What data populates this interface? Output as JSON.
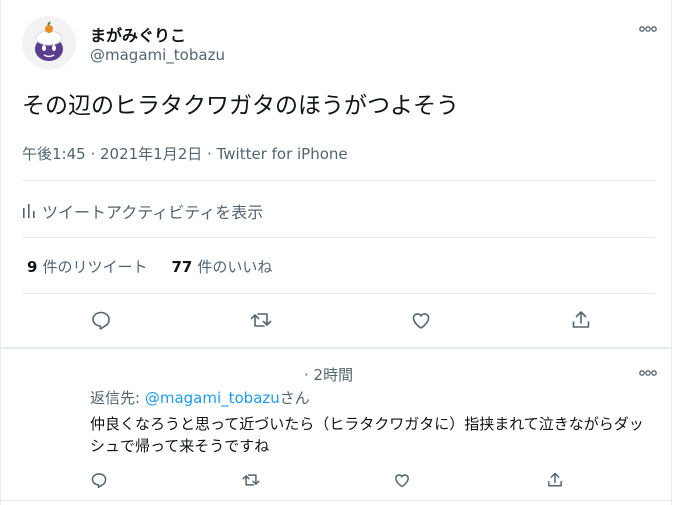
{
  "tweet": {
    "display_name": "まがみぐりこ",
    "handle": "@magami_tobazu",
    "text": "その辺のヒラタクワガタのほうがつよそう",
    "time": "午後1:45",
    "date": "2021年1月2日",
    "source": "Twitter for iPhone",
    "separator": " · "
  },
  "activity": {
    "label": "ツイートアクティビティを表示"
  },
  "stats": {
    "retweets_count": "9",
    "retweets_label": "件のリツイート",
    "likes_count": "77",
    "likes_label": "件のいいね"
  },
  "actions": [
    "reply-icon",
    "retweet-icon",
    "like-icon",
    "share-icon"
  ],
  "reply": {
    "time": "· 2時間",
    "replying_prefix": "返信先: ",
    "replying_mention": "@magami_tobazu",
    "replying_suffix": "さん",
    "text": "仲良くなろうと思って近づいたら（ヒラタクワガタに）指挟まれて泣きながらダッシュで帰って来そうですね"
  },
  "colors": {
    "accent": "#1d9bf0",
    "secondary_text": "#536471",
    "divider": "#e6ecf0"
  }
}
